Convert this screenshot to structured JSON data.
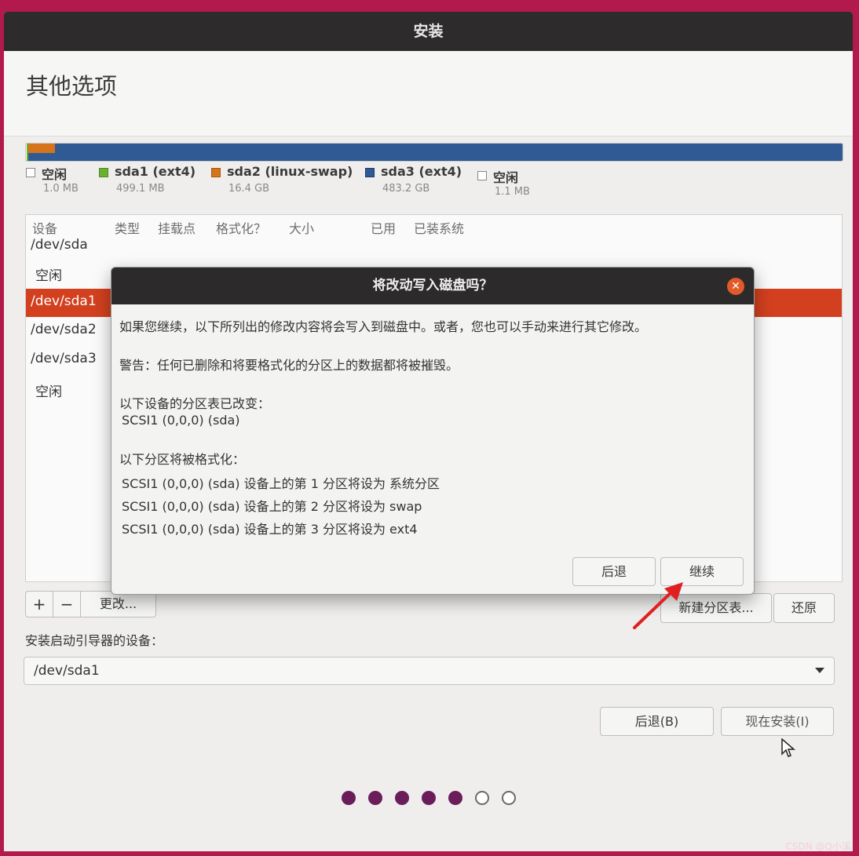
{
  "window": {
    "title": "安装"
  },
  "page": {
    "title": "其他选项"
  },
  "partition_legend": [
    {
      "name": "空闲",
      "size": "1.0 MB",
      "color": "#ffffff"
    },
    {
      "name": "sda1 (ext4)",
      "size": "499.1 MB",
      "color": "#6bb12f"
    },
    {
      "name": "sda2 (linux-swap)",
      "size": "16.4 GB",
      "color": "#d5741b"
    },
    {
      "name": "sda3 (ext4)",
      "size": "483.2 GB",
      "color": "#2f5a94"
    },
    {
      "name": "空闲",
      "size": "1.1 MB",
      "color": "#ffffff"
    }
  ],
  "table": {
    "headers": [
      "设备",
      "类型",
      "挂载点",
      "格式化？",
      "大小",
      "已用",
      "已装系统"
    ],
    "rows": [
      {
        "device": "/dev/sda",
        "selected": false
      },
      {
        "device": "空闲",
        "selected": false
      },
      {
        "device": "/dev/sda1",
        "selected": true
      },
      {
        "device": "/dev/sda2",
        "selected": false
      },
      {
        "device": "/dev/sda3",
        "selected": false
      },
      {
        "device": "空闲",
        "selected": false
      }
    ]
  },
  "toolbar": {
    "add": "+",
    "remove": "−",
    "change": "更改...",
    "new_table": "新建分区表...",
    "revert": "还原"
  },
  "bootloader": {
    "label": "安装启动引导器的设备：",
    "value": "/dev/sda1"
  },
  "nav": {
    "back": "后退(B)",
    "install_now": "现在安装(I)"
  },
  "progress": {
    "total_steps": 7,
    "completed_steps": 5
  },
  "dialog": {
    "title": "将改动写入磁盘吗？",
    "line1": "如果您继续，以下所列出的修改内容将会写入到磁盘中。或者，您也可以手动来进行其它修改。",
    "warning": "警告：任何已删除和将要格式化的分区上的数据都将被摧毁。",
    "table_changed_heading": "以下设备的分区表已改变：",
    "table_changed_device": "SCSI1 (0,0,0) (sda)",
    "format_heading": "以下分区将被格式化：",
    "format_items": [
      "SCSI1 (0,0,0) (sda) 设备上的第 1 分区将设为 系统分区",
      "SCSI1 (0,0,0) (sda) 设备上的第 2 分区将设为 swap",
      "SCSI1 (0,0,0) (sda) 设备上的第 3 分区将设为 ext4"
    ],
    "back": "后退",
    "continue": "继续"
  },
  "watermark": "CSDN @Q小溪"
}
